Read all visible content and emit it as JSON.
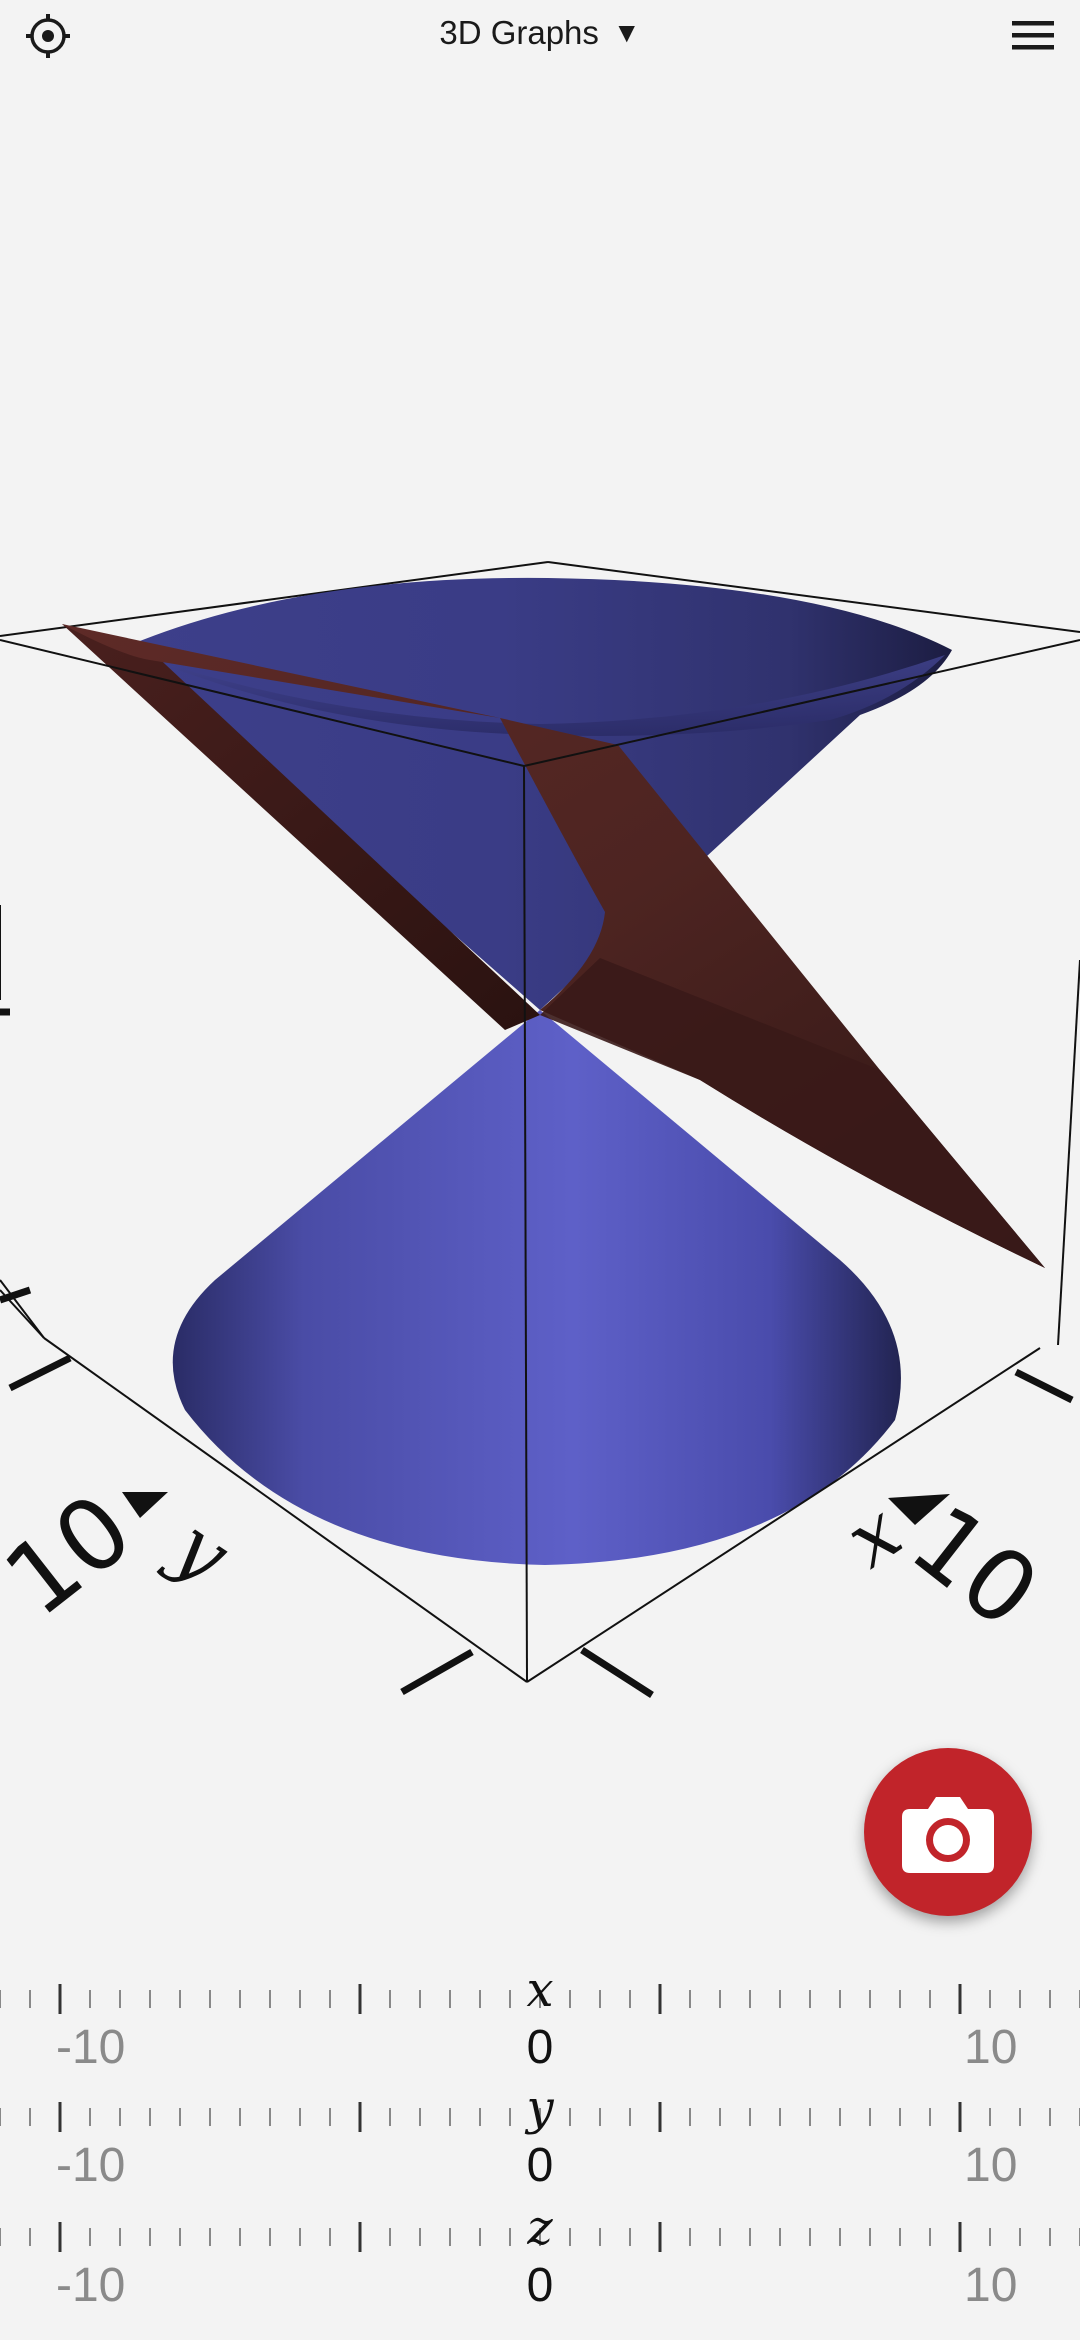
{
  "header": {
    "title": "3D Graphs",
    "settings_icon": "settings-icon",
    "menu_icon": "hamburger-menu-icon"
  },
  "graph": {
    "cone_color": "#5a5cc4",
    "plane_color": "#6b2d2a",
    "axis_labels": {
      "x_axis": "x",
      "x_tick": "10",
      "y_axis": "y",
      "y_tick": "10"
    }
  },
  "screenshot_button": {
    "icon": "camera-icon",
    "color": "#c1242a"
  },
  "sliders": [
    {
      "name": "x",
      "min": "-10",
      "max": "10",
      "value": "0"
    },
    {
      "name": "y",
      "min": "-10",
      "max": "10",
      "value": "0"
    },
    {
      "name": "z",
      "min": "-10",
      "max": "10",
      "value": "0"
    }
  ]
}
